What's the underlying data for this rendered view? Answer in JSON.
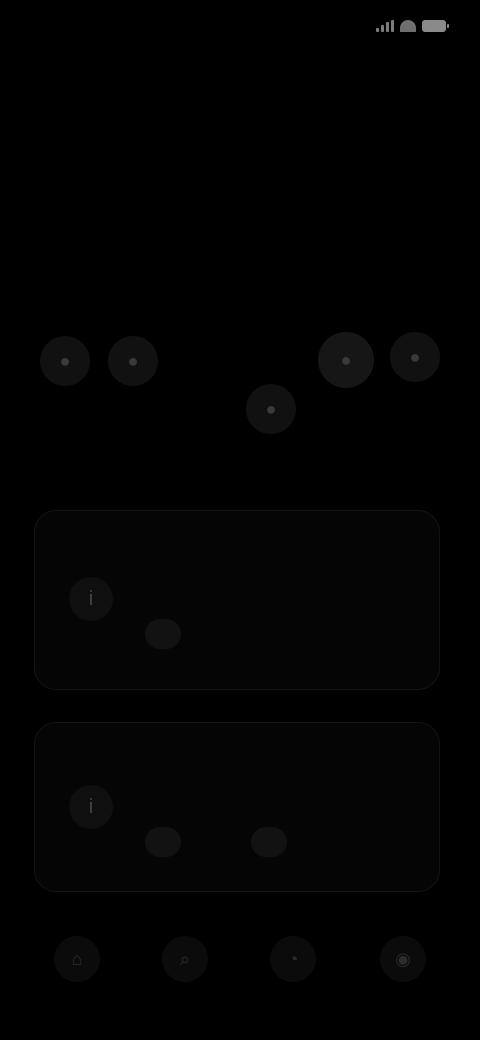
{
  "status_bar": {
    "time": "",
    "icons": [
      "signal-icon",
      "wifi-icon",
      "battery-icon"
    ]
  },
  "page": {
    "title": "",
    "description": ""
  },
  "quick_actions": [
    {
      "icon": "circle-icon",
      "label": ""
    },
    {
      "icon": "circle-icon",
      "label": ""
    },
    {
      "icon": "circle-icon",
      "label": ""
    },
    {
      "icon": "circle-icon",
      "label": ""
    },
    {
      "icon": "circle-icon",
      "label": ""
    }
  ],
  "cards": [
    {
      "icon": "info-icon",
      "title": "",
      "subtitle": "",
      "buttons": [
        ""
      ]
    },
    {
      "icon": "info-icon",
      "title": "",
      "subtitle": "",
      "buttons": [
        "",
        ""
      ]
    }
  ],
  "bottom_nav": [
    {
      "icon": "home-icon"
    },
    {
      "icon": "search-icon"
    },
    {
      "icon": "notifications-icon"
    },
    {
      "icon": "profile-icon"
    }
  ],
  "colors": {
    "background": "#000000",
    "card": "#050505",
    "muted_text": "#6d6d6d",
    "accent_time": "#7a6a58"
  }
}
